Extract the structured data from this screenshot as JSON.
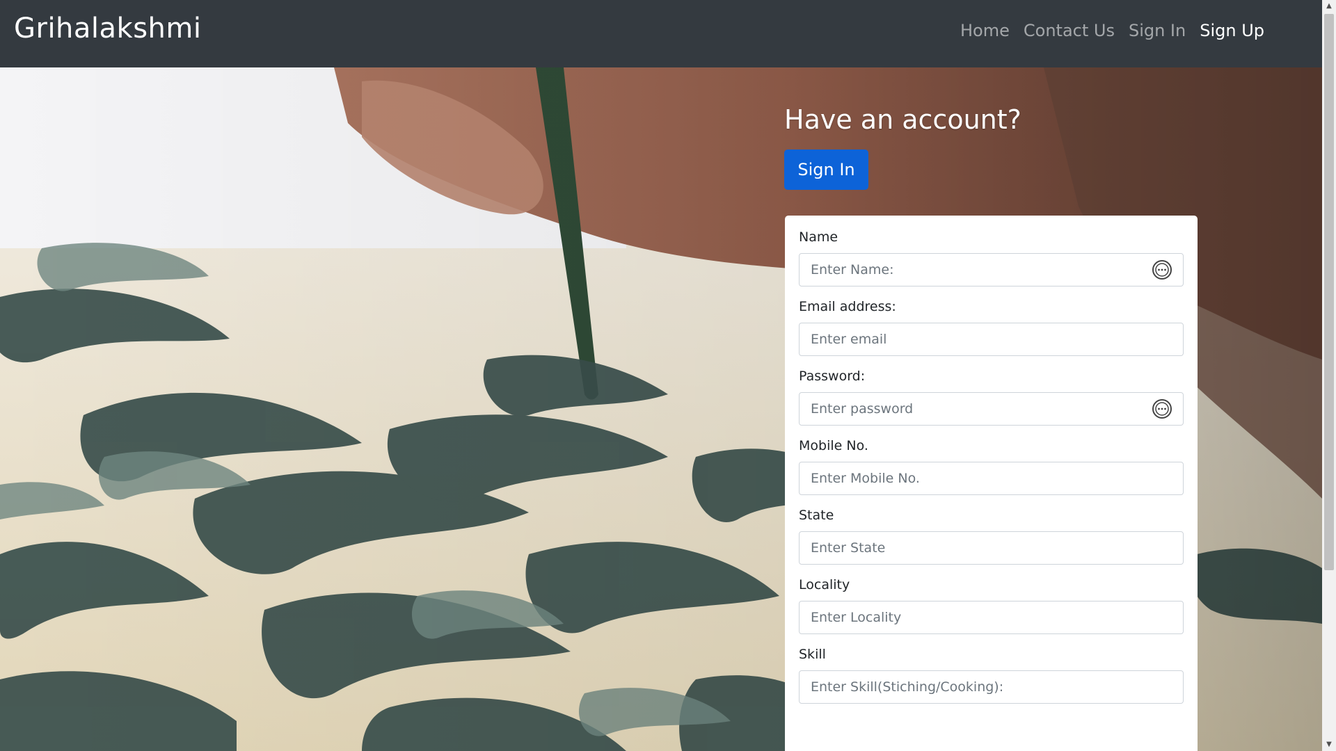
{
  "navbar": {
    "brand": "Grihalakshmi",
    "links": [
      {
        "label": "Home"
      },
      {
        "label": "Contact Us"
      },
      {
        "label": "Sign In"
      },
      {
        "label": "Sign Up"
      }
    ]
  },
  "hero": {
    "heading": "Have an account?",
    "signin_button": "Sign In"
  },
  "form": {
    "fields": [
      {
        "label": "Name",
        "placeholder": "Enter Name:",
        "has_autofill_icon": true
      },
      {
        "label": "Email address:",
        "placeholder": "Enter email",
        "has_autofill_icon": false
      },
      {
        "label": "Password:",
        "placeholder": "Enter password",
        "has_autofill_icon": true
      },
      {
        "label": "Mobile No.",
        "placeholder": "Enter Mobile No.",
        "has_autofill_icon": false
      },
      {
        "label": "State",
        "placeholder": "Enter State",
        "has_autofill_icon": false
      },
      {
        "label": "Locality",
        "placeholder": "Enter Locality",
        "has_autofill_icon": false
      },
      {
        "label": "Skill",
        "placeholder": "Enter Skill(Stiching/Cooking):",
        "has_autofill_icon": false
      }
    ]
  },
  "colors": {
    "navbar": "#343a40",
    "primary": "#0d63d8",
    "nav_link": "rgba(255,255,255,0.55)",
    "nav_active": "#ffffff"
  },
  "icons": {
    "autofill": "password-manager-icon"
  }
}
